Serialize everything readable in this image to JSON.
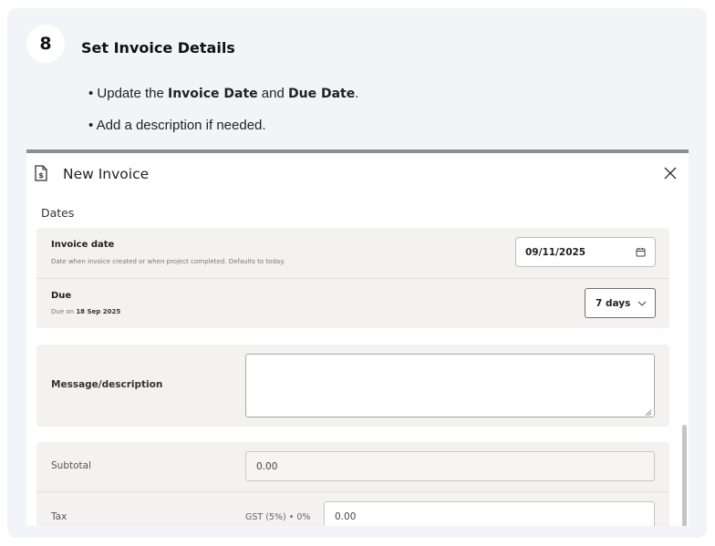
{
  "step": {
    "number": "8",
    "title": "Set Invoice Details",
    "bullets": {
      "b1_pre": "• Update the ",
      "b1_bold1": "Invoice Date",
      "b1_mid": " and ",
      "b1_bold2": "Due Date",
      "b1_post": ".",
      "b2": "• Add a description if needed."
    }
  },
  "modal": {
    "title": "New Invoice",
    "icons": {
      "header": "invoice-dollar-icon",
      "close": "close-icon"
    }
  },
  "dates": {
    "section_label": "Dates",
    "invoice_date": {
      "label": "Invoice date",
      "help": "Date when invoice created or when project completed. Defaults to today.",
      "value": "09/11/2025",
      "icon": "calendar-icon"
    },
    "due": {
      "label": "Due",
      "help_prefix": "Due on ",
      "help_date": "18 Sep 2025",
      "selected": "7 days",
      "icon": "chevron-down-icon"
    }
  },
  "message": {
    "label": "Message/description",
    "value": ""
  },
  "totals": {
    "subtotal_label": "Subtotal",
    "subtotal_value": "0.00",
    "tax_label": "Tax",
    "tax_rate": "GST (5%) • 0%",
    "tax_value": "0.00"
  },
  "colors": {
    "card_bg": "#f2f4f7",
    "panel_bg": "#f3f2f1",
    "screenshot_border": "#8d8d8d"
  }
}
